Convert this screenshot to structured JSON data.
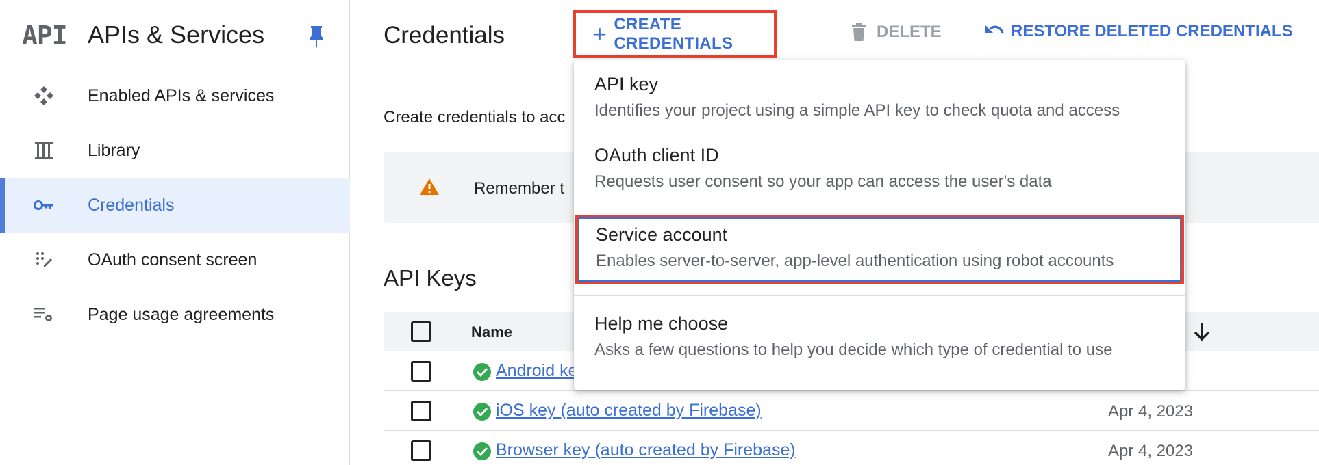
{
  "sidebar": {
    "logo_text": "API",
    "title": "APIs & Services",
    "items": [
      {
        "label": "Enabled APIs & services",
        "icon": "enabled-apis-icon",
        "active": false
      },
      {
        "label": "Library",
        "icon": "library-icon",
        "active": false
      },
      {
        "label": "Credentials",
        "icon": "key-icon",
        "active": true
      },
      {
        "label": "OAuth consent screen",
        "icon": "oauth-consent-icon",
        "active": false
      },
      {
        "label": "Page usage agreements",
        "icon": "page-usage-settings-icon",
        "active": false
      }
    ]
  },
  "toolbar": {
    "page_title": "Credentials",
    "create_label": "CREATE CREDENTIALS",
    "delete_label": "DELETE",
    "restore_label": "RESTORE DELETED CREDENTIALS"
  },
  "content": {
    "intro_text": "Create credentials to acc",
    "banner_text": "Remember t",
    "section_title": "API Keys",
    "table": {
      "name_header": "Name",
      "rows": [
        {
          "name": "Android ke",
          "date": ""
        },
        {
          "name": "iOS key (auto created by Firebase)",
          "date": "Apr 4, 2023"
        },
        {
          "name": "Browser key (auto created by Firebase)",
          "date": "Apr 4, 2023"
        }
      ]
    }
  },
  "dropdown": {
    "items": [
      {
        "title": "API key",
        "description": "Identifies your project using a simple API key to check quota and access"
      },
      {
        "title": "OAuth client ID",
        "description": "Requests user consent so your app can access the user's data"
      },
      {
        "title": "Service account",
        "description": "Enables server-to-server, app-level authentication using robot accounts"
      },
      {
        "title": "Help me choose",
        "description": "Asks a few questions to help you decide which type of credential to use"
      }
    ]
  },
  "colors": {
    "accent": "#3b6fd6",
    "highlight_border": "#e8412e",
    "warning": "#e37400",
    "success": "#34a853"
  }
}
